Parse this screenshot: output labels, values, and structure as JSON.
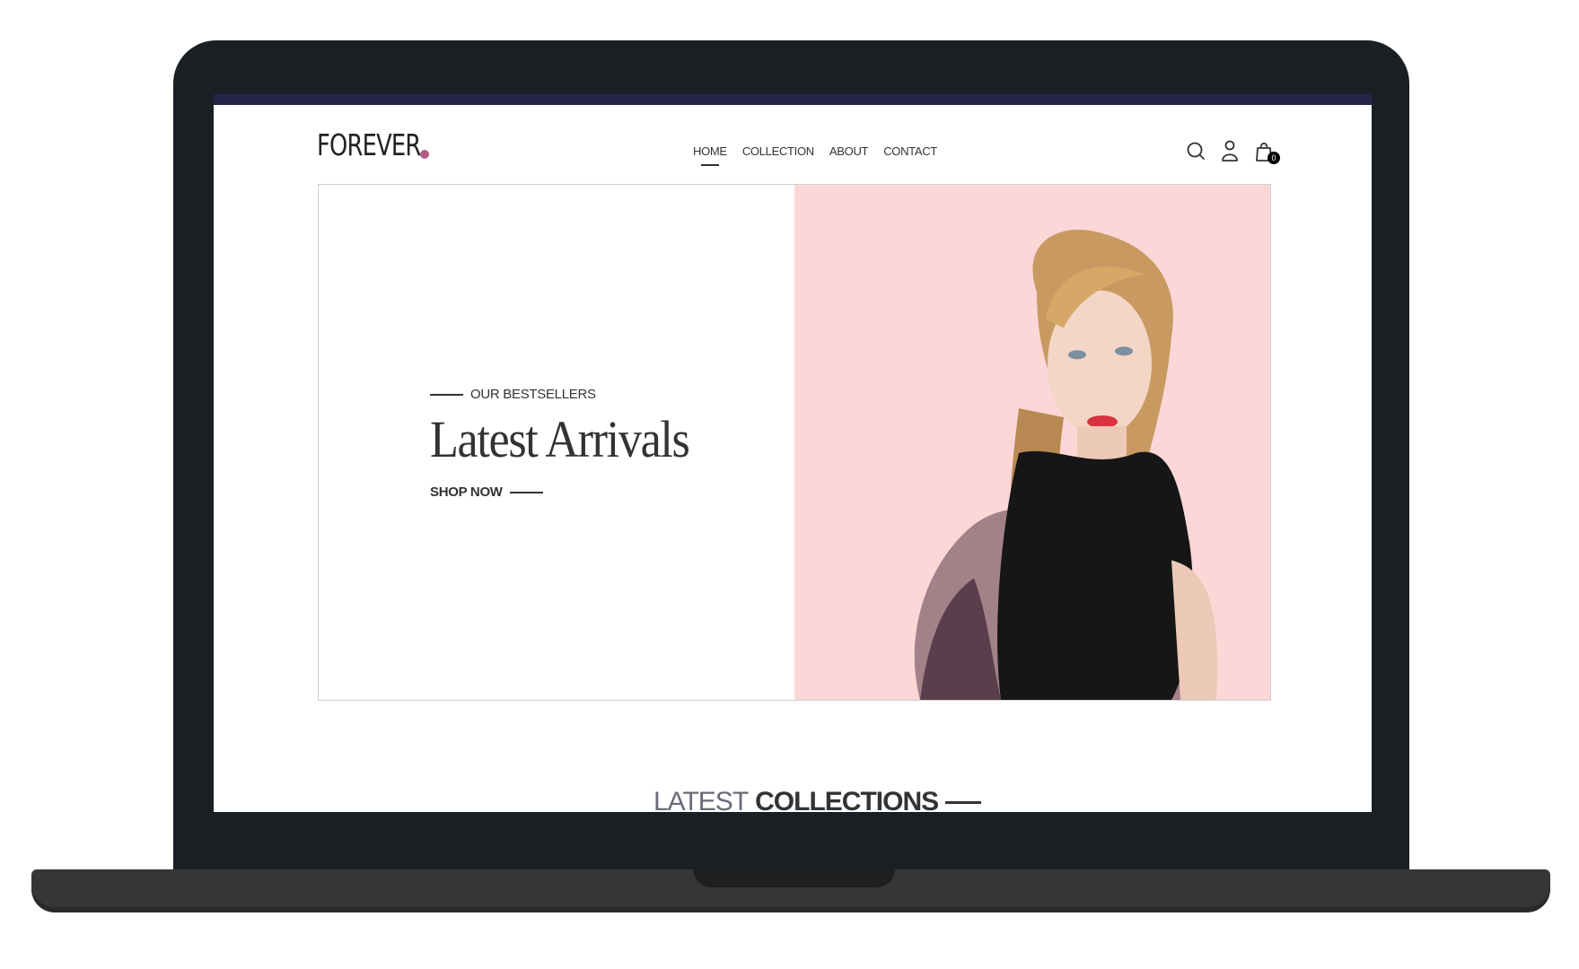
{
  "brand": {
    "logo_text": "FOREVER",
    "accent": "#b05c85"
  },
  "nav": {
    "items": [
      {
        "label": "HOME",
        "active": true
      },
      {
        "label": "COLLECTION",
        "active": false
      },
      {
        "label": "ABOUT",
        "active": false
      },
      {
        "label": "CONTACT",
        "active": false
      }
    ]
  },
  "header_icons": {
    "search": "search-icon",
    "profile": "user-icon",
    "cart": "shopping-bag-icon",
    "cart_count": "0"
  },
  "hero": {
    "eyebrow": "OUR BESTSELLERS",
    "title": "Latest Arrivals",
    "cta": "SHOP NOW",
    "image_background": "#fdd7d7"
  },
  "section": {
    "title_light": "LATEST",
    "title_strong": "COLLECTIONS"
  }
}
